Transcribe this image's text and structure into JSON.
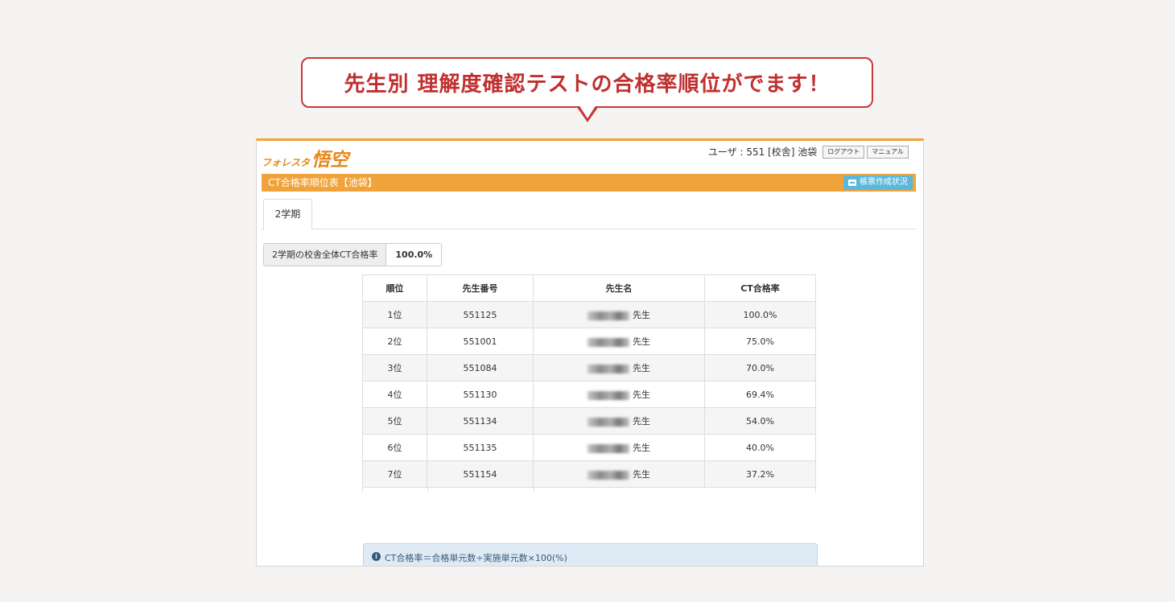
{
  "callout": {
    "text": "先生別 理解度確認テストの合格率順位がでます！"
  },
  "header": {
    "logo_sub": "フォレスタ",
    "logo_main": "悟空",
    "user_text": "ユーザ : 551 [校舎] 池袋",
    "logout_label": "ログアウト",
    "manual_label": "マニュアル"
  },
  "title_bar": {
    "title": "CT合格率順位表【池袋】",
    "report_button": "帳票作成状況"
  },
  "tabs": [
    {
      "label": "2学期"
    }
  ],
  "overall": {
    "label": "2学期の校舎全体CT合格率",
    "value": "100.0%"
  },
  "table": {
    "headers": [
      "順位",
      "先生番号",
      "先生名",
      "CT合格率"
    ],
    "honorific": "先生",
    "rows": [
      {
        "rank": "1位",
        "number": "551125",
        "rate": "100.0%"
      },
      {
        "rank": "2位",
        "number": "551001",
        "rate": "75.0%"
      },
      {
        "rank": "3位",
        "number": "551084",
        "rate": "70.0%"
      },
      {
        "rank": "4位",
        "number": "551130",
        "rate": "69.4%"
      },
      {
        "rank": "5位",
        "number": "551134",
        "rate": "54.0%"
      },
      {
        "rank": "6位",
        "number": "551135",
        "rate": "40.0%"
      },
      {
        "rank": "7位",
        "number": "551154",
        "rate": "37.2%"
      }
    ]
  },
  "info": {
    "icon": "info-icon",
    "text": "CT合格率＝合格単元数÷実施単元数×100(%)"
  },
  "colors": {
    "accent_orange": "#f0a33a",
    "callout_red": "#c9383b",
    "report_button_blue": "#5bb8dc",
    "info_bg": "#dfeaf5"
  }
}
